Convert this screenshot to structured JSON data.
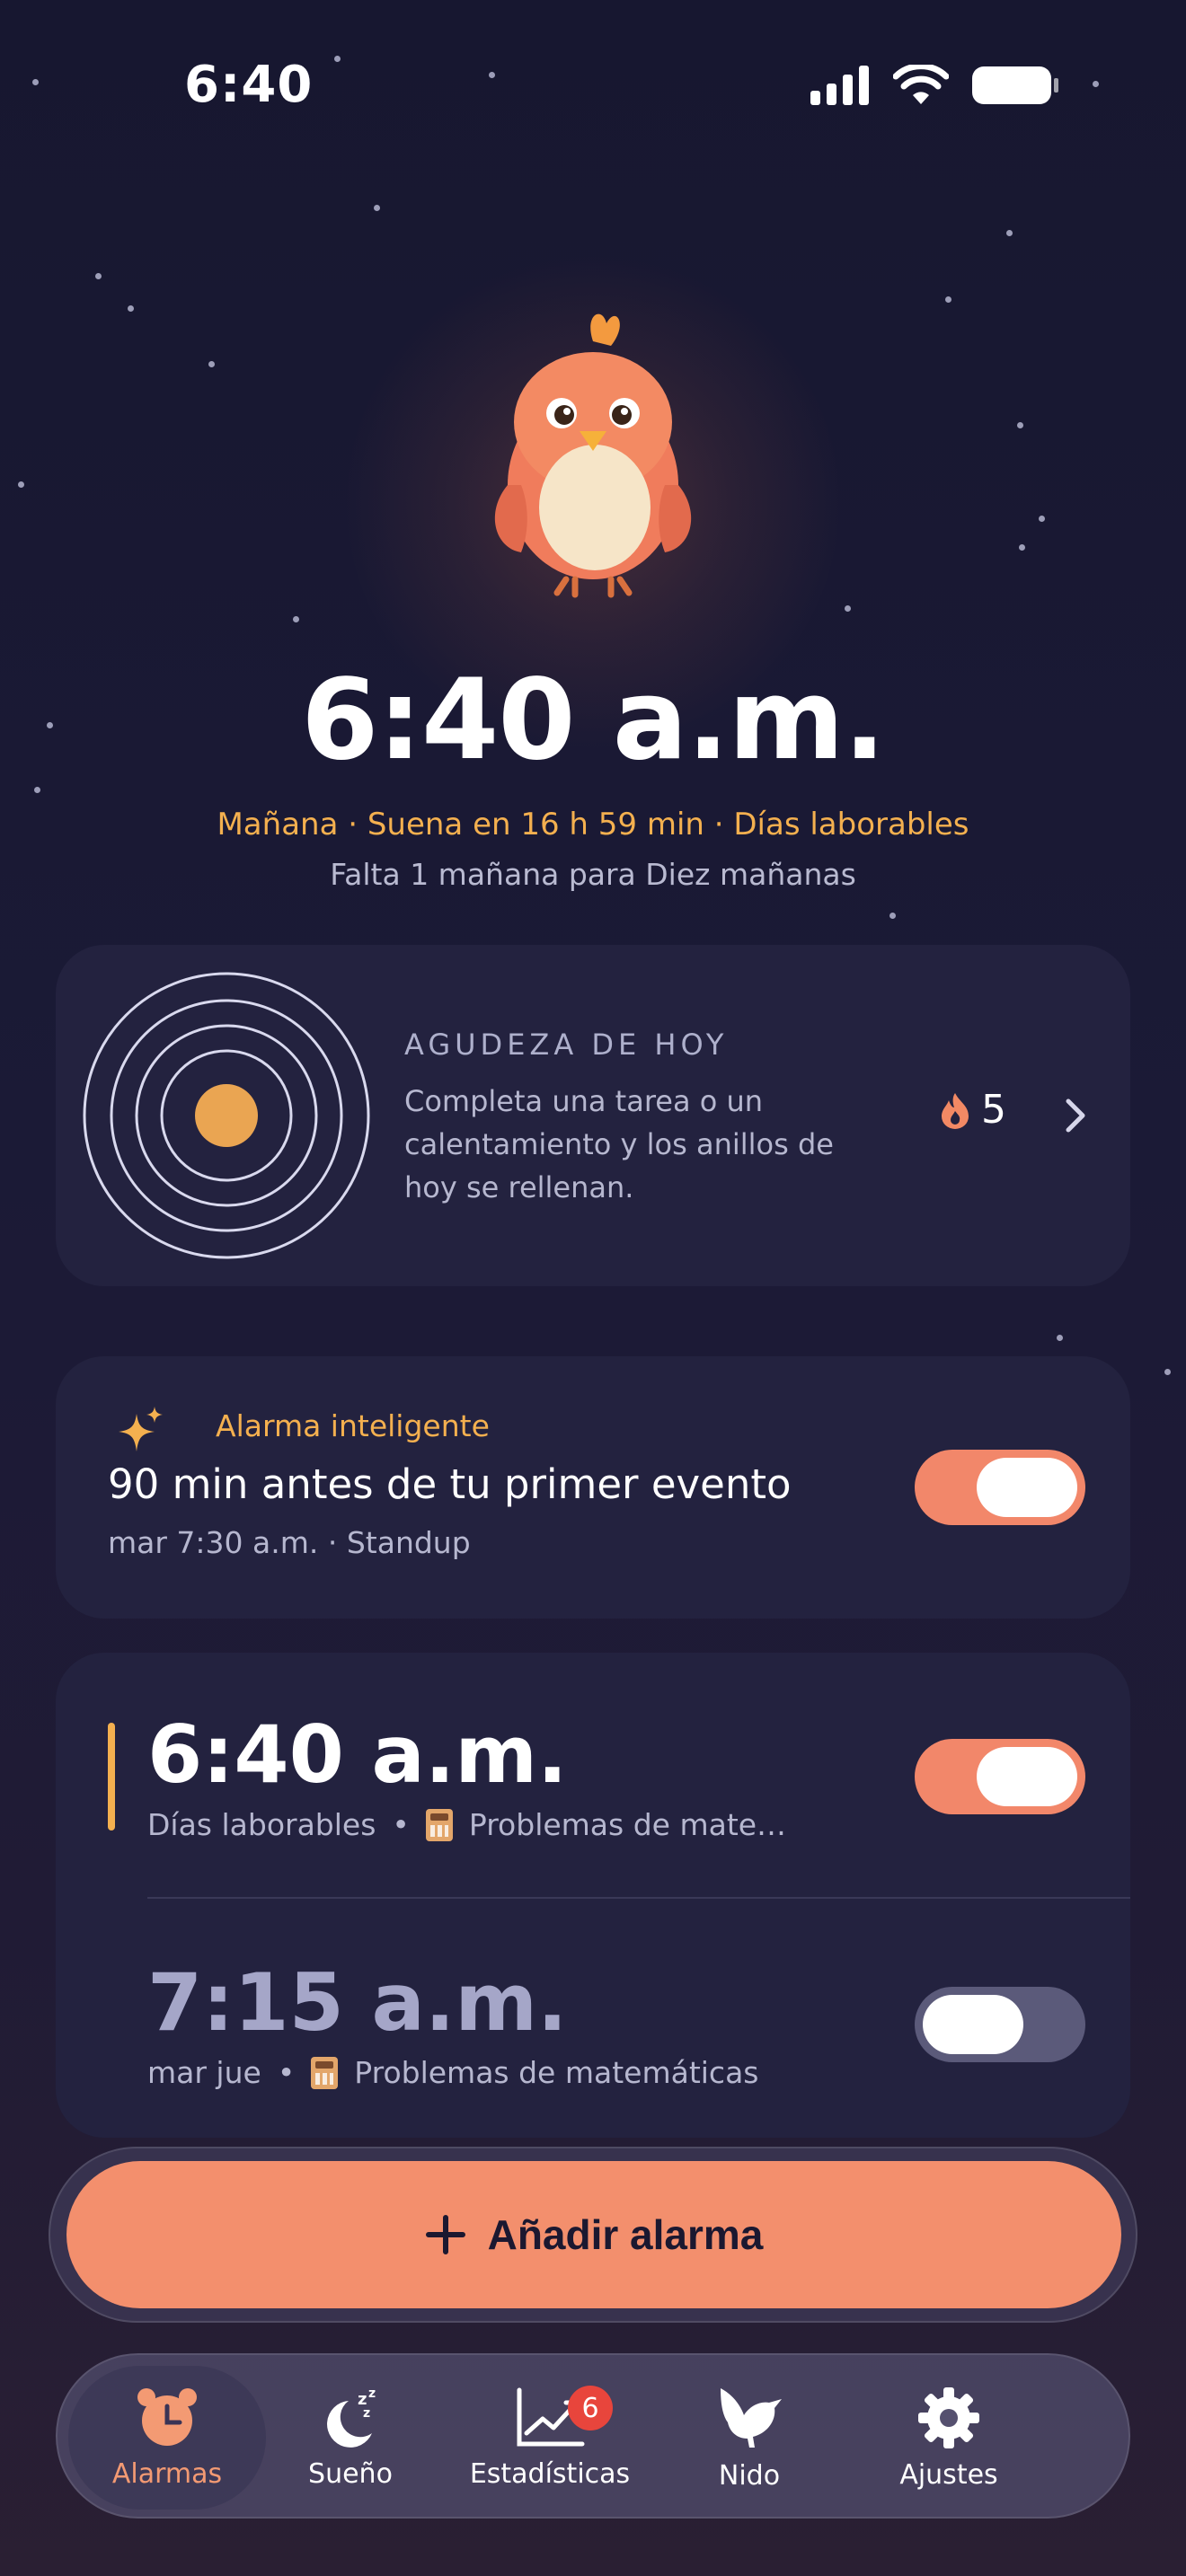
{
  "status_bar": {
    "time": "6:40"
  },
  "hero": {
    "alarm_time": "6:40 a.m.",
    "subtitle": "Mañana · Suena en 16 h 59 min · Días laborables",
    "note": "Falta 1 mañana para Diez mañanas"
  },
  "focus": {
    "title": "AGUDEZA DE HOY",
    "description": "Completa una tarea o un calentamiento y los anillos de hoy se rellenan.",
    "streak": "5"
  },
  "smart_alarm": {
    "label": "Alarma inteligente",
    "title": "90 min antes de tu primer evento",
    "meta": "mar 7:30 a.m. · Standup",
    "enabled": true
  },
  "alarms": [
    {
      "time": "6:40 a.m.",
      "days": "Días laborables",
      "task": "Problemas de mate…",
      "enabled": true
    },
    {
      "time": "7:15 a.m.",
      "days": "mar jue",
      "task": "Problemas de matemáticas",
      "enabled": false
    }
  ],
  "add_button": {
    "label": "Añadir alarma"
  },
  "tabs": [
    {
      "label": "Alarmas",
      "icon": "alarm-clock-icon",
      "active": true
    },
    {
      "label": "Sueño",
      "icon": "moon-zzz-icon"
    },
    {
      "label": "Estadísticas",
      "icon": "chart-icon",
      "badge": "6"
    },
    {
      "label": "Nido",
      "icon": "bird-icon"
    },
    {
      "label": "Ajustes",
      "icon": "gear-icon"
    }
  ],
  "colors": {
    "accent": "#f38f6d",
    "gold": "#f4b04f",
    "card": "#23223f",
    "background": "#171730"
  }
}
